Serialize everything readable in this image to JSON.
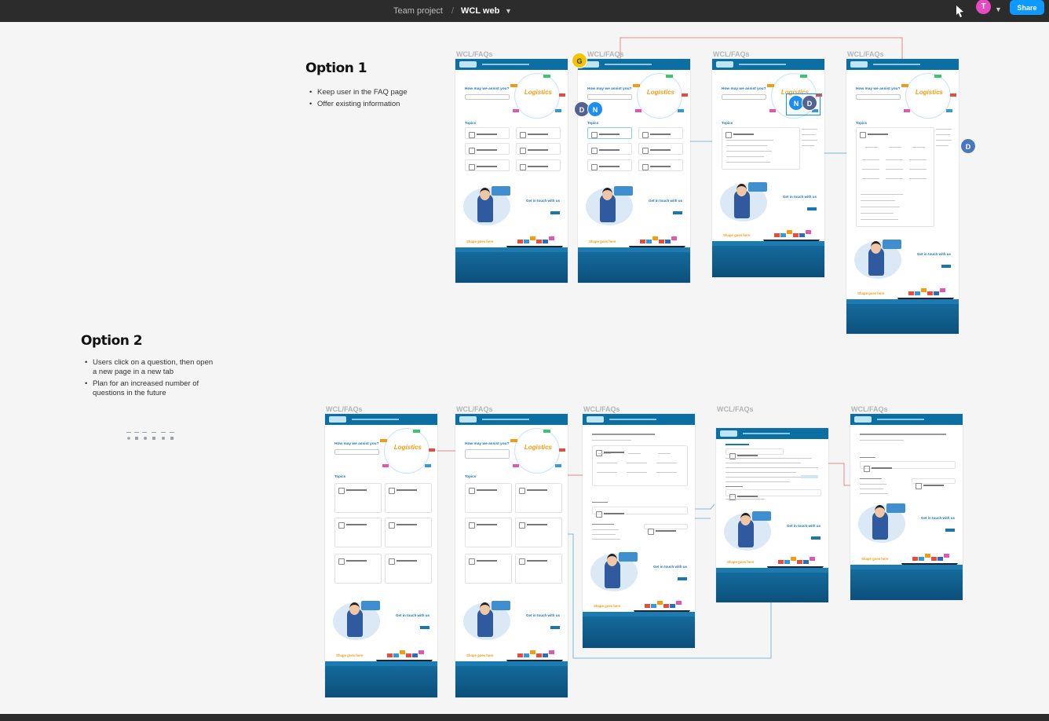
{
  "header": {
    "project": "Team project",
    "separator": "/",
    "file": "WCL web",
    "avatar_initial": "T",
    "share_label": "Share"
  },
  "icons": {
    "cursor": "cursor-arrow-icon",
    "chevron": "chevron-down-icon"
  },
  "colors": {
    "toolbar_bg": "#2c2c2c",
    "accent": "#0d99ff",
    "brand_blue": "#0b6fa4",
    "logistics_orange": "#f39c12",
    "connector_red": "#e05a5a",
    "connector_blue": "#5aa6d6"
  },
  "option1": {
    "title": "Option 1",
    "bullets": [
      "Keep user in the FAQ page",
      "Offer existing information"
    ]
  },
  "option2": {
    "title": "Option 2",
    "bullets": [
      "Users click on a question, then open a new page in a new tab",
      "Plan for an increased number of questions in the future"
    ]
  },
  "frame_label": "WCL/FAQs",
  "mockup": {
    "hero_heading": "How may we assist you?",
    "hero_word": "Logistics",
    "topics": "Topics",
    "get_in_touch": "Get in touch with us",
    "footer_cta": "Shape goes here"
  },
  "collaborators": {
    "g": "G",
    "d": "D",
    "n": "N"
  }
}
